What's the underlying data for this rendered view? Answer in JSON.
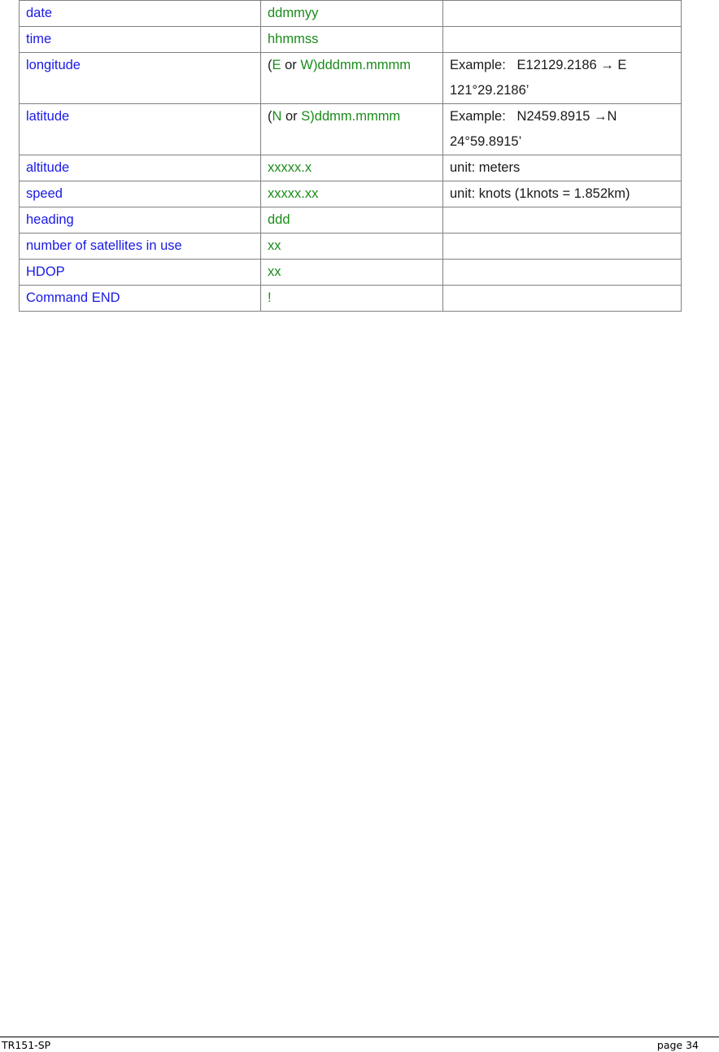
{
  "table": {
    "rows": [
      {
        "field": "date",
        "format": "ddmmyy",
        "note": ""
      },
      {
        "field": "time",
        "format": "hhmmss",
        "note": ""
      },
      {
        "field": "longitude",
        "format_parts": [
          "(",
          "E",
          " or ",
          "W",
          ")dddmm.mmmm"
        ],
        "note_lines": [
          "Example:   E12129.2186 → E",
          "121°29.2186’"
        ]
      },
      {
        "field": "latitude",
        "format_parts": [
          "(",
          "N",
          " or ",
          "S",
          ")ddmm.mmmm"
        ],
        "note_lines": [
          "Example:   N2459.8915 →N",
          "24°59.8915’"
        ]
      },
      {
        "field": "altitude",
        "format": "xxxxx.x",
        "note": "unit: meters"
      },
      {
        "field": "speed",
        "format": "xxxxx.xx",
        "note": "unit: knots (1knots = 1.852km)"
      },
      {
        "field": "heading",
        "format": "ddd",
        "note": ""
      },
      {
        "field": "number of satellites in use",
        "format": "xx",
        "note": ""
      },
      {
        "field": "HDOP",
        "format": "xx",
        "note": ""
      },
      {
        "field": "Command END",
        "format": "!",
        "note": ""
      }
    ]
  },
  "colors": {
    "field": "#1a1ae6",
    "format": "#1a8c1a",
    "note": "#1a1a1a"
  },
  "footer": {
    "doc_id": "TR151-SP",
    "page": "page 34"
  }
}
